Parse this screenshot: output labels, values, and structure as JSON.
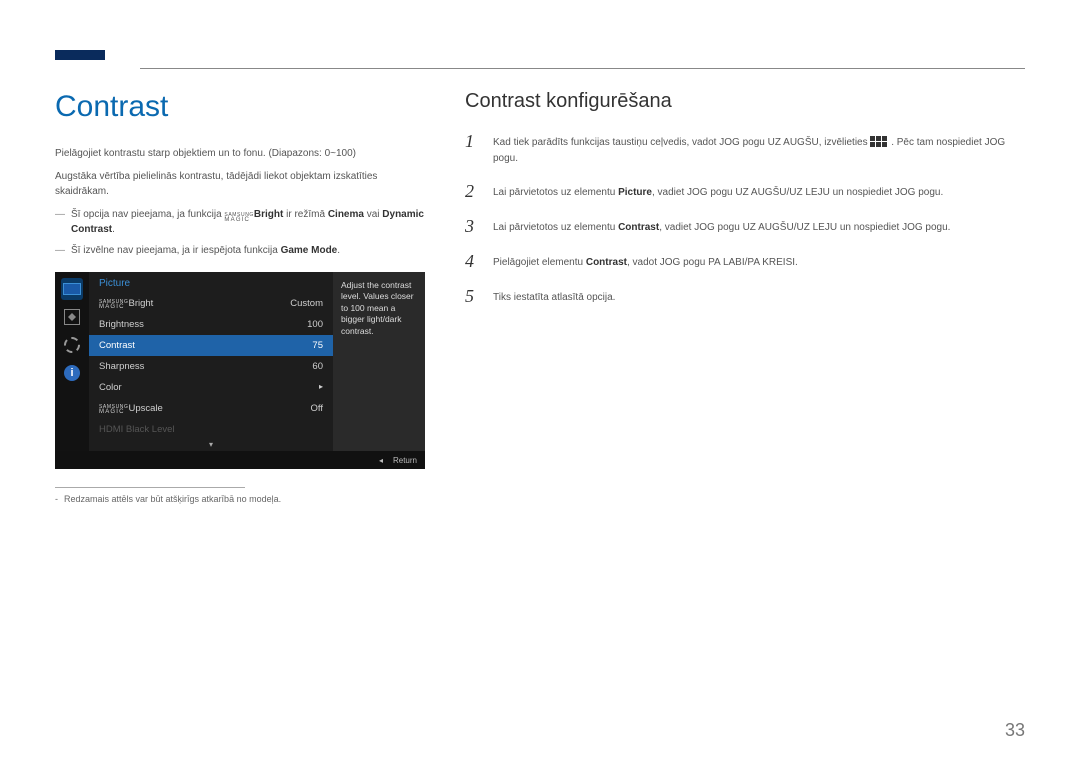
{
  "header": {
    "accent_color": "#0a2b5c"
  },
  "left": {
    "title": "Contrast",
    "p1": "Pielāgojiet kontrastu starp objektiem un to fonu. (Diapazons: 0~100)",
    "p2": "Augstāka vērtība pielielinās kontrastu, tādējādi liekot objektam izskatīties skaidrākam.",
    "note1": {
      "dash": "―",
      "pre": "Šī opcija nav pieejama, ja funkcija ",
      "magic_top": "SAMSUNG",
      "magic_bot": "MAGIC",
      "bright": "Bright",
      "mid": " ir režīmā ",
      "cinema": "Cinema",
      "or": " vai ",
      "dyn": "Dynamic Contrast",
      "end": "."
    },
    "note2": {
      "dash": "―",
      "pre": "Šī izvēlne nav pieejama, ja ir iespējota funkcija ",
      "gm": "Game Mode",
      "end": "."
    },
    "footnote": {
      "dash": "-",
      "text": "Redzamais attēls var būt atšķirīgs atkarībā no modeļa."
    }
  },
  "osd": {
    "title": "Picture",
    "rows": {
      "r1_label_magic_top": "SAMSUNG",
      "r1_label_magic_bot": "MAGIC",
      "r1_suffix": "Bright",
      "r1_val": "Custom",
      "r2_label": "Brightness",
      "r2_val": "100",
      "r3_label": "Contrast",
      "r3_val": "75",
      "r4_label": "Sharpness",
      "r4_val": "60",
      "r5_label": "Color",
      "r5_val": "▸",
      "r6_label_magic_top": "SAMSUNG",
      "r6_label_magic_bot": "MAGIC",
      "r6_suffix": "Upscale",
      "r6_val": "Off",
      "r7_label": "HDMI Black Level"
    },
    "help": "Adjust the contrast level. Values closer to 100 mean a bigger light/dark contrast.",
    "scroll_down": "▾",
    "foot_left": "◂",
    "foot_return": "Return",
    "side_info": "i"
  },
  "right": {
    "title": "Contrast konfigurēšana",
    "s1": {
      "num": "1",
      "a": "Kad tiek parādīts funkcijas taustiņu ceļvedis, vadot JOG pogu UZ AUGŠU, izvēlieties ",
      "b": ". Pēc tam nospiediet JOG pogu."
    },
    "s2": {
      "num": "2",
      "a": "Lai pārvietotos uz elementu ",
      "pic": "Picture",
      "b": ", vadiet JOG pogu UZ AUGŠU/UZ LEJU un nospiediet JOG pogu."
    },
    "s3": {
      "num": "3",
      "a": "Lai pārvietotos uz elementu ",
      "con": "Contrast",
      "b": ", vadiet JOG pogu UZ AUGŠU/UZ LEJU un nospiediet JOG pogu."
    },
    "s4": {
      "num": "4",
      "a": "Pielāgojiet elementu ",
      "con": "Contrast",
      "b": ", vadot JOG pogu PA LABI/PA KREISI."
    },
    "s5": {
      "num": "5",
      "a": "Tiks iestatīta atlasītā opcija."
    }
  },
  "page_number": "33"
}
